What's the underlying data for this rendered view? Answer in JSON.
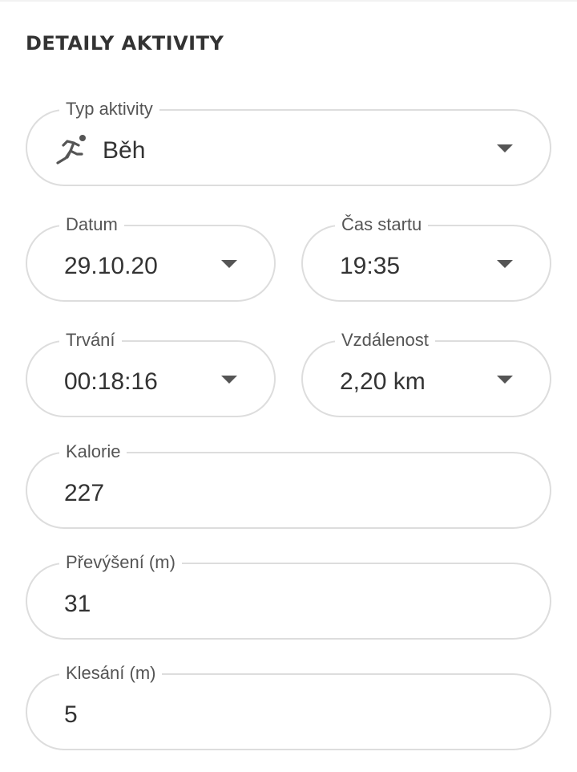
{
  "section": {
    "title": "DETAILY AKTIVITY"
  },
  "fields": {
    "activity_type": {
      "label": "Typ aktivity",
      "value": "Běh",
      "icon": "running-person-icon"
    },
    "date": {
      "label": "Datum",
      "value": "29.10.20"
    },
    "start_time": {
      "label": "Čas startu",
      "value": "19:35"
    },
    "duration": {
      "label": "Trvání",
      "value": "00:18:16"
    },
    "distance": {
      "label": "Vzdálenost",
      "value": "2,20 km"
    },
    "calories": {
      "label": "Kalorie",
      "value": "227"
    },
    "elevation_gain": {
      "label": "Převýšení (m)",
      "value": "31"
    },
    "elevation_loss": {
      "label": "Klesání (m)",
      "value": "5"
    }
  },
  "colors": {
    "border": "#dddddd",
    "text": "#333333",
    "label": "#555555"
  }
}
